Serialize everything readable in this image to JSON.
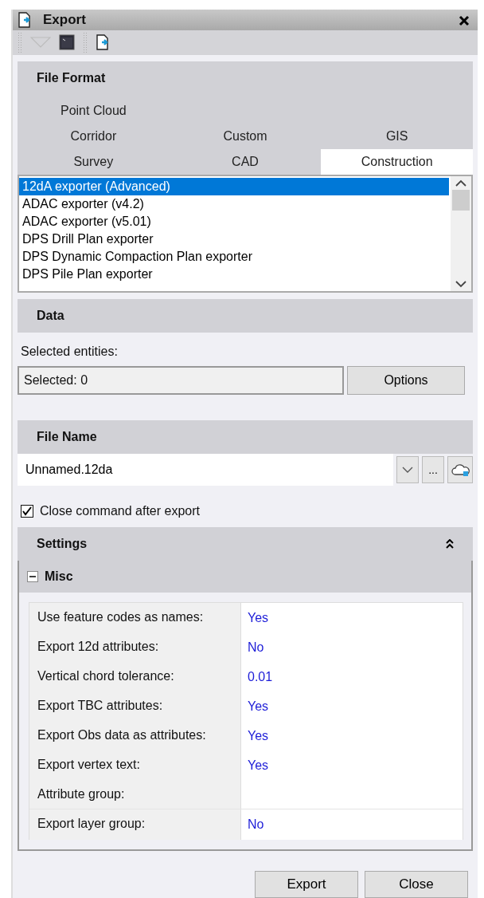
{
  "window": {
    "title": "Export"
  },
  "file_format": {
    "title": "File Format",
    "tab_rows": [
      [
        {
          "label": "Point Cloud",
          "selected": false
        }
      ],
      [
        {
          "label": "Corridor",
          "selected": false
        },
        {
          "label": "Custom",
          "selected": false
        },
        {
          "label": "GIS",
          "selected": false
        }
      ],
      [
        {
          "label": "Survey",
          "selected": false
        },
        {
          "label": "CAD",
          "selected": false
        },
        {
          "label": "Construction",
          "selected": true
        }
      ]
    ],
    "exporters": [
      {
        "label": "12dA exporter (Advanced)",
        "selected": true
      },
      {
        "label": "ADAC exporter (v4.2)",
        "selected": false
      },
      {
        "label": "ADAC exporter (v5.01)",
        "selected": false
      },
      {
        "label": "DPS Drill Plan exporter",
        "selected": false
      },
      {
        "label": "DPS Dynamic Compaction Plan exporter",
        "selected": false
      },
      {
        "label": "DPS Pile Plan exporter",
        "selected": false
      }
    ]
  },
  "data": {
    "title": "Data",
    "label": "Selected entities:",
    "value": "Selected: 0",
    "options_button": "Options"
  },
  "file_name": {
    "title": "File Name",
    "value": "Unnamed.12da",
    "browse_button": "..."
  },
  "close_after_export": {
    "label": "Close command after export",
    "checked": true
  },
  "settings": {
    "title": "Settings",
    "group": {
      "title": "Misc",
      "expanded": true,
      "properties": [
        {
          "name": "Use feature codes as names:",
          "value": "Yes"
        },
        {
          "name": "Export 12d attributes:",
          "value": "No"
        },
        {
          "name": "Vertical chord tolerance:",
          "value": "0.01"
        },
        {
          "name": "Export TBC attributes:",
          "value": "Yes"
        },
        {
          "name": "Export Obs data as attributes:",
          "value": "Yes"
        },
        {
          "name": "Export vertex text:",
          "value": "Yes"
        },
        {
          "name": "Attribute group:"
        },
        {
          "name": "Export layer group:",
          "value": "No"
        }
      ]
    }
  },
  "buttons": [
    "Export",
    "Close"
  ]
}
